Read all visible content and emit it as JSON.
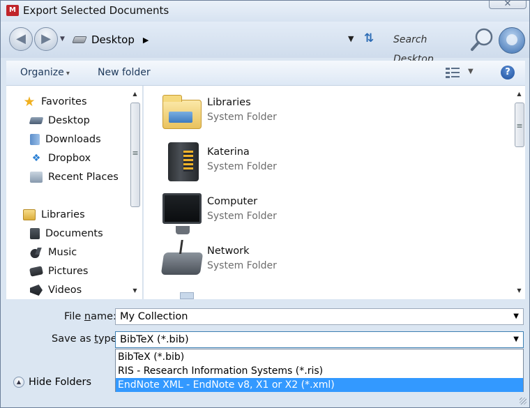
{
  "window": {
    "title": "Export Selected Documents",
    "app_icon_text": "M",
    "close_glyph": "✕"
  },
  "address": {
    "back_glyph": "◀",
    "forward_glyph": "▶",
    "breadcrumb": "Desktop",
    "search_placeholder": "Search Desktop"
  },
  "toolbar": {
    "organize_label": "Organize",
    "new_folder_label": "New folder",
    "help_glyph": "?"
  },
  "sidebar": {
    "items": [
      {
        "label": "Favorites",
        "icon": "star-icon",
        "group": true
      },
      {
        "label": "Desktop",
        "icon": "desktop-icon"
      },
      {
        "label": "Downloads",
        "icon": "downloads-icon"
      },
      {
        "label": "Dropbox",
        "icon": "dropbox-icon"
      },
      {
        "label": "Recent Places",
        "icon": "recent-places-icon"
      },
      {
        "label": "Libraries",
        "icon": "libraries-icon",
        "group": true
      },
      {
        "label": "Documents",
        "icon": "documents-icon"
      },
      {
        "label": "Music",
        "icon": "music-icon"
      },
      {
        "label": "Pictures",
        "icon": "pictures-icon"
      },
      {
        "label": "Videos",
        "icon": "videos-icon"
      }
    ]
  },
  "content": {
    "items": [
      {
        "name": "Libraries",
        "kind": "System Folder",
        "icon": "libraries-folder-icon"
      },
      {
        "name": "Katerina",
        "kind": "System Folder",
        "icon": "user-folder-icon"
      },
      {
        "name": "Computer",
        "kind": "System Folder",
        "icon": "computer-icon"
      },
      {
        "name": "Network",
        "kind": "System Folder",
        "icon": "network-icon"
      }
    ]
  },
  "form": {
    "file_name_label_pre": "File ",
    "file_name_label_u": "n",
    "file_name_label_post": "ame:",
    "file_name_value": "My Collection",
    "save_type_label_pre": "Save as ",
    "save_type_label_u": "t",
    "save_type_label_post": "ype:",
    "save_type_value": "BibTeX (*.bib)",
    "options": [
      "BibTeX (*.bib)",
      "RIS - Research Information Systems (*.ris)",
      "EndNote XML - EndNote v8, X1 or X2 (*.xml)"
    ],
    "hide_folders_label": "Hide Folders"
  },
  "colors": {
    "selection": "#3399ff",
    "frame": "#dbe6f2"
  }
}
